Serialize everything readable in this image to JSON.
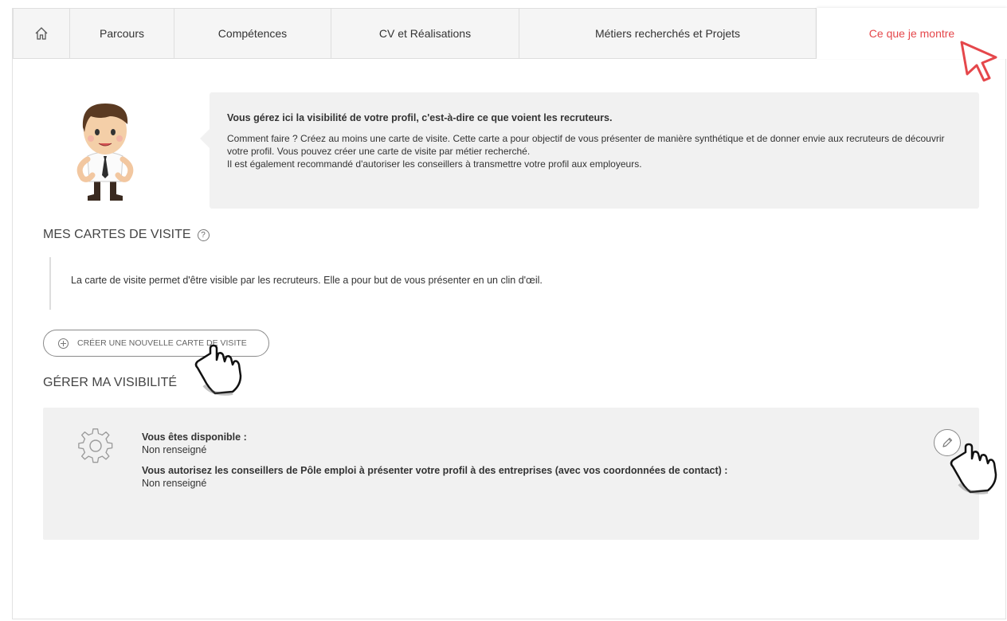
{
  "tabs": [
    {
      "label": "",
      "icon": "home-icon"
    },
    {
      "label": "Parcours"
    },
    {
      "label": "Compétences"
    },
    {
      "label": "CV et Réalisations"
    },
    {
      "label": "Métiers recherchés et Projets"
    },
    {
      "label": "Ce que je montre",
      "active": true
    }
  ],
  "info": {
    "title": "Vous gérez ici la visibilité de votre profil, c'est-à-dire ce que voient les recruteurs.",
    "line1": "Comment faire ? Créez au moins une carte de visite. Cette carte a pour objectif de vous présenter de manière synthétique et de donner envie aux recruteurs de découvrir votre profil. Vous pouvez créer une carte de visite par métier recherché.",
    "line2": "Il est également recommandé d'autoriser les conseillers à transmettre votre profil aux employeurs."
  },
  "cards": {
    "title": "MES CARTES DE VISITE",
    "help": "?",
    "description": "La carte de visite permet d'être visible par les recruteurs. Elle a pour but de vous présenter en un clin d'œil.",
    "create_label": "CRÉER UNE NOUVELLE CARTE DE VISITE"
  },
  "visibility": {
    "title": "GÉRER MA VISIBILITÉ",
    "available_label": "Vous êtes disponible :",
    "available_value": "Non renseigné",
    "authorize_label": "Vous autorisez les conseillers de Pôle emploi à présenter votre profil à des entreprises (avec vos coordonnées de contact) :",
    "authorize_value": "Non renseigné"
  },
  "colors": {
    "accent": "#e5474b",
    "panel": "#f1f1f1",
    "tab_bg": "#f5f5f5"
  }
}
